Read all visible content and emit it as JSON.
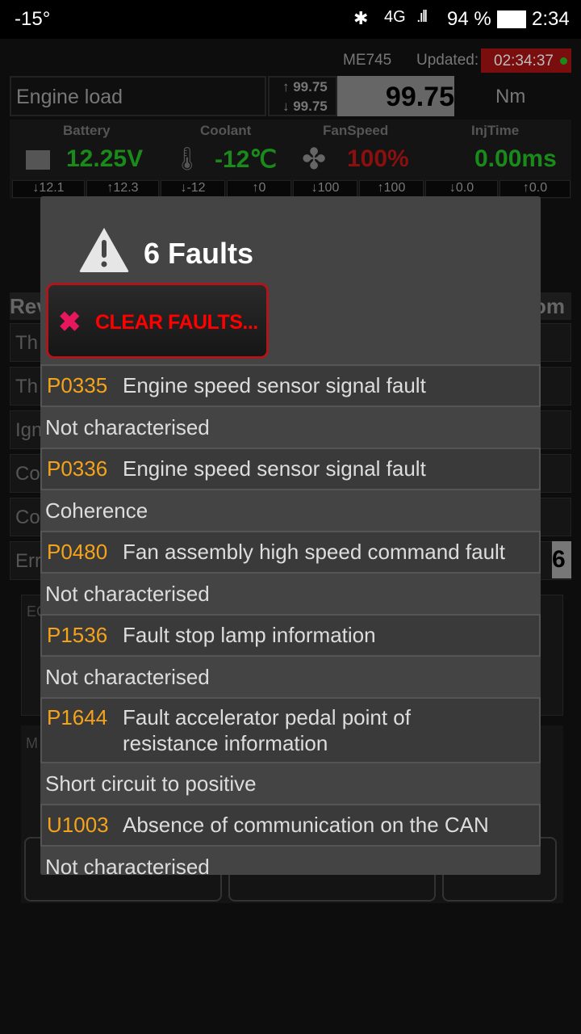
{
  "status_bar": {
    "temperature": "-15°",
    "network": "4G",
    "battery": "94 %",
    "time": "2:34"
  },
  "header": {
    "ecu": "ME745",
    "updated_label": "Updated:",
    "updated_time": "02:34:37"
  },
  "main_param": {
    "label": "Engine load",
    "max": "↑ 99.75",
    "min": "↓ 99.75",
    "value": "99.75",
    "unit": "Nm"
  },
  "gauges": [
    {
      "label": "Battery",
      "value": "12.25V",
      "color": "#1a8a1a",
      "icon": "battery-icon",
      "min": "↓12.1",
      "max": "↑12.3"
    },
    {
      "label": "Coolant",
      "value": "-12℃",
      "color": "#1a8a1a",
      "icon": "thermometer-icon",
      "min": "↓-12",
      "max": "↑0"
    },
    {
      "label": "FanSpeed",
      "value": "100%",
      "color": "#8a0f0f",
      "icon": "fan-icon",
      "min": "↓100",
      "max": "↑100"
    },
    {
      "label": "InjTime",
      "value": "0.00ms",
      "color": "#1a8a1a",
      "icon": "",
      "min": "↓0.0",
      "max": "↑0.0"
    }
  ],
  "background_fragments": {
    "section_left": "Rev",
    "section_right": "om",
    "rows": [
      "Th",
      "Th",
      "Ign",
      "Co",
      "Co",
      "Err"
    ],
    "err_count": "6",
    "ec": "EC",
    "m": "M"
  },
  "dialog": {
    "title": "6 Faults",
    "clear_label": "CLEAR FAULTS...",
    "faults": [
      {
        "code": "P0335",
        "description": "Engine speed sensor signal fault",
        "status": "Not characterised"
      },
      {
        "code": "P0336",
        "description": "Engine speed sensor signal fault",
        "status": "Coherence"
      },
      {
        "code": "P0480",
        "description": "Fan assembly high speed command fault",
        "status": "Not characterised"
      },
      {
        "code": "P1536",
        "description": "Fault stop lamp information",
        "status": "Not characterised"
      },
      {
        "code": "P1644",
        "description": "Fault accelerator pedal point of resistance information",
        "status": "Short circuit to positive"
      },
      {
        "code": "U1003",
        "description": "Absence of communication on the CAN",
        "status": "Not characterised"
      }
    ]
  }
}
